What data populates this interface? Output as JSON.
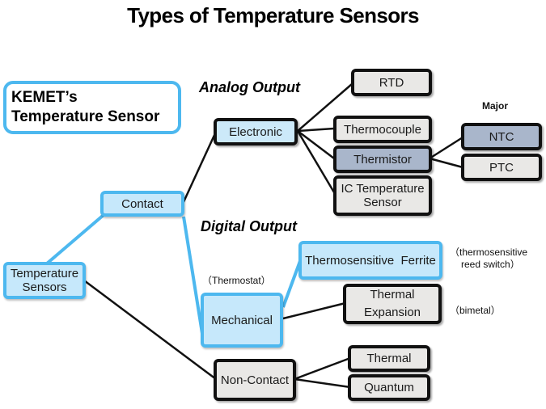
{
  "title": "Types of Temperature Sensors",
  "badge": {
    "line1": "KEMET’s",
    "line2": "Temperature Sensor"
  },
  "sections": {
    "analog": "Analog Output",
    "digital": "Digital Output"
  },
  "labels": {
    "major": "Major"
  },
  "nodes": {
    "root": {
      "line1": "Temperature",
      "line2": "Sensors"
    },
    "contact": "Contact",
    "non_contact": "Non-Contact",
    "electronic": "Electronic",
    "mechanical": "Mechanical",
    "rtd": "RTD",
    "thermocouple": "Thermocouple",
    "thermistor": "Thermistor",
    "ic_sensor": {
      "line1": "IC Temperature",
      "line2": "Sensor"
    },
    "ntc": "NTC",
    "ptc": "PTC",
    "ferrite": "Thermosensitive  Ferrite",
    "thermal_expansion": {
      "line1": "Thermal",
      "line2": "Expansion"
    },
    "thermal": "Thermal",
    "quantum": "Quantum"
  },
  "notes": {
    "thermostat": "（Thermostat）",
    "reed_switch": {
      "line1": "（thermosensitive",
      "line2": "reed switch）"
    },
    "bimetal": "（bimetal）"
  },
  "colors": {
    "accent_blue": "#4db8ef",
    "light_blue_fill": "#c6e8fb",
    "highlight_slate": "#a9b6cb",
    "grey_fill": "#e9e8e6",
    "outline_dark": "#111111"
  }
}
